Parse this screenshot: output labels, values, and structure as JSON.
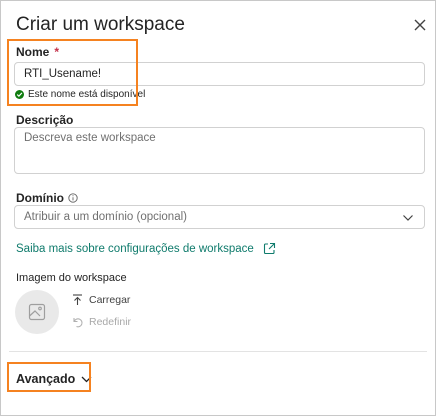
{
  "dialog": {
    "title": "Criar um workspace"
  },
  "name": {
    "label": "Nome",
    "required_marker": "*",
    "value": "RTI_Usename!",
    "validation": "Este nome está disponível",
    "validation_color": "#107c10"
  },
  "description": {
    "label": "Descrição",
    "placeholder": "Descreva este workspace"
  },
  "domain": {
    "label": "Domínio",
    "info_icon": "info-icon",
    "placeholder": "Atribuir a um domínio (opcional)"
  },
  "learn_more": {
    "text": "Saiba mais sobre configurações de workspace",
    "icon": "external-link-icon",
    "color": "#0f7b6c"
  },
  "image": {
    "label": "Imagem do workspace",
    "upload_label": "Carregar",
    "reset_label": "Redefinir"
  },
  "advanced": {
    "label": "Avançado"
  },
  "highlight_color": "#f58220"
}
